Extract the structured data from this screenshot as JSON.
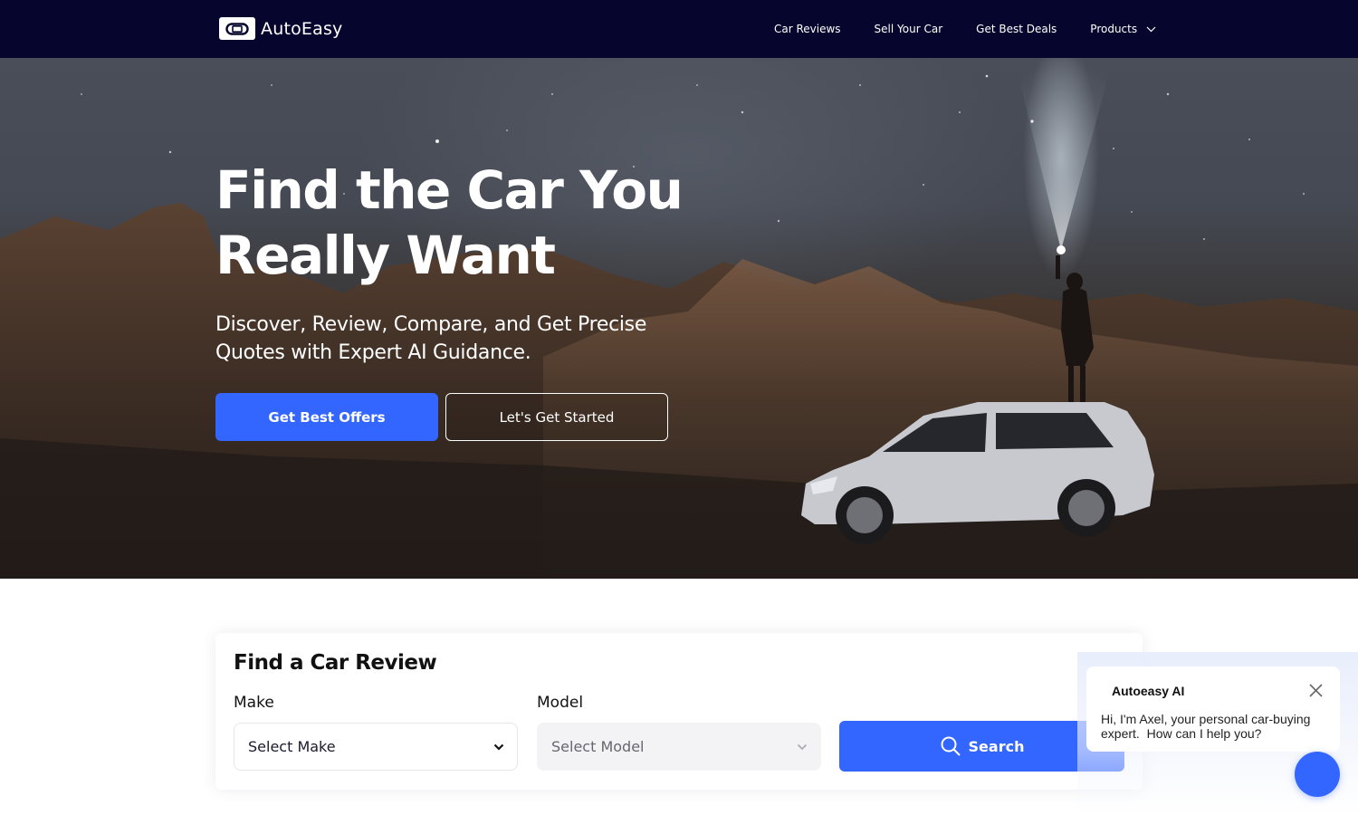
{
  "nav": {
    "brand": "AutoEasy",
    "links": [
      {
        "label": "Car Reviews"
      },
      {
        "label": "Sell Your Car"
      },
      {
        "label": "Get Best Deals"
      },
      {
        "label": "Products",
        "icon": "chevron-down-icon"
      }
    ]
  },
  "hero": {
    "title_line1": "Find the Car You",
    "title_line2": "Really Want",
    "subtitle": "Discover, Review, Compare, and Get Precise Quotes with Expert AI Guidance.",
    "primary_button": "Get Best Offers",
    "secondary_button": "Let's Get Started"
  },
  "search_card": {
    "title": "Find a Car Review",
    "make_label": "Make",
    "make_value": "Select Make",
    "model_label": "Model",
    "model_value": "Select Model",
    "search_button": "Search"
  },
  "chat": {
    "title": "Autoeasy AI",
    "message": "Hi, I'm Axel, your personal car-buying expert.  How can I help you?"
  },
  "colors": {
    "nav_bg": "#05052e",
    "accent": "#3366ff",
    "text_dark": "#111111"
  }
}
